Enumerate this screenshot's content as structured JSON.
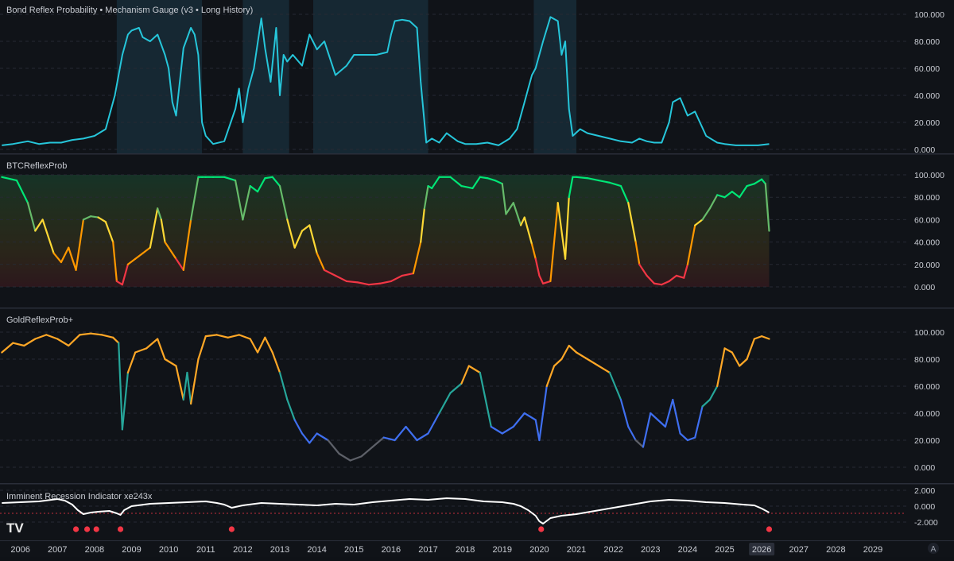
{
  "chart_data": [
    {
      "type": "line",
      "title": "Bond Reflex Probability • Mechanism Gauge (v3 • Long History)",
      "ylim": [
        0,
        100
      ],
      "y_ticks": [
        "100.000",
        "80.000",
        "60.000",
        "40.000",
        "20.000",
        "0.000"
      ],
      "grid": true,
      "line_color": "#26c6da",
      "series": [
        {
          "x": [
            2005.5,
            2005.8,
            2006.2,
            2006.5,
            2006.8,
            2007.1,
            2007.4,
            2007.7,
            2008.0,
            2008.3,
            2008.55,
            2008.75,
            2008.9,
            2009.0,
            2009.2,
            2009.3,
            2009.5,
            2009.7,
            2009.9,
            2010.0,
            2010.1,
            2010.2,
            2010.4,
            2010.6,
            2010.7,
            2010.8,
            2010.9,
            2011.0,
            2011.2,
            2011.5,
            2011.8,
            2011.9,
            2012.0,
            2012.15,
            2012.3,
            2012.5,
            2012.6,
            2012.75,
            2012.9,
            2013.0,
            2013.1,
            2013.2,
            2013.35,
            2013.6,
            2013.8,
            2014.0,
            2014.2,
            2014.5,
            2014.8,
            2015.0,
            2015.3,
            2015.6,
            2015.9,
            2016.0,
            2016.1,
            2016.3,
            2016.5,
            2016.7,
            2016.8,
            2016.95,
            2017.1,
            2017.3,
            2017.5,
            2017.8,
            2018.0,
            2018.3,
            2018.6,
            2018.9,
            2019.2,
            2019.4,
            2019.6,
            2019.7,
            2019.8,
            2019.9,
            2020.0,
            2020.1,
            2020.3,
            2020.5,
            2020.6,
            2020.7,
            2020.8,
            2020.9,
            2021.1,
            2021.3,
            2021.6,
            2021.9,
            2022.2,
            2022.5,
            2022.7,
            2022.9,
            2023.1,
            2023.3,
            2023.5,
            2023.6,
            2023.8,
            2024.0,
            2024.2,
            2024.5,
            2024.8,
            2025.0,
            2025.3,
            2025.6,
            2025.9,
            2026.2
          ],
          "y": [
            3,
            4,
            6,
            4,
            5,
            5,
            7,
            8,
            10,
            15,
            40,
            70,
            85,
            88,
            90,
            83,
            80,
            85,
            70,
            60,
            35,
            25,
            75,
            90,
            85,
            70,
            20,
            10,
            4,
            6,
            30,
            45,
            20,
            45,
            60,
            97,
            75,
            50,
            90,
            40,
            70,
            65,
            70,
            62,
            85,
            74,
            80,
            55,
            62,
            70,
            70,
            70,
            72,
            85,
            95,
            96,
            95,
            90,
            50,
            5,
            8,
            5,
            12,
            6,
            4,
            4,
            5,
            3,
            8,
            15,
            35,
            45,
            55,
            60,
            70,
            80,
            98,
            95,
            70,
            80,
            30,
            10,
            15,
            12,
            10,
            8,
            6,
            5,
            8,
            6,
            5,
            5,
            20,
            35,
            38,
            25,
            28,
            10,
            5,
            4,
            3,
            3,
            3,
            4
          ],
          "highlight_bands": [
            [
              2008.6,
              2010.9
            ],
            [
              2012.0,
              2013.25
            ],
            [
              2013.9,
              2017.0
            ],
            [
              2019.85,
              2021.0
            ]
          ]
        }
      ]
    },
    {
      "type": "line",
      "title": "BTCReflexProb",
      "ylim": [
        0,
        100
      ],
      "y_ticks": [
        "100.000",
        "80.000",
        "60.000",
        "40.000",
        "20.000",
        "0.000"
      ],
      "grid": true,
      "colored_by_value": true,
      "zones": [
        {
          "from": 0,
          "to": 20,
          "color": "#f23645"
        },
        {
          "from": 20,
          "to": 40,
          "color": "#ff9800"
        },
        {
          "from": 40,
          "to": 60,
          "color": "#fdd835"
        },
        {
          "from": 60,
          "to": 80,
          "color": "#66bb6a"
        },
        {
          "from": 80,
          "to": 100,
          "color": "#00e676"
        }
      ],
      "series": [
        {
          "x": [
            2005.5,
            2005.9,
            2006.2,
            2006.4,
            2006.6,
            2006.9,
            2007.1,
            2007.3,
            2007.5,
            2007.7,
            2007.9,
            2008.1,
            2008.3,
            2008.5,
            2008.6,
            2008.75,
            2008.9,
            2009.1,
            2009.3,
            2009.5,
            2009.7,
            2009.8,
            2009.9,
            2010.0,
            2010.2,
            2010.4,
            2010.6,
            2010.8,
            2010.9,
            2011.0,
            2011.2,
            2011.5,
            2011.8,
            2012.0,
            2012.2,
            2012.4,
            2012.6,
            2012.8,
            2013.0,
            2013.2,
            2013.4,
            2013.6,
            2013.8,
            2014.0,
            2014.2,
            2014.5,
            2014.8,
            2015.1,
            2015.4,
            2015.7,
            2016.0,
            2016.3,
            2016.6,
            2016.8,
            2016.9,
            2017.0,
            2017.1,
            2017.3,
            2017.6,
            2017.9,
            2018.2,
            2018.4,
            2018.6,
            2018.8,
            2019.0,
            2019.1,
            2019.3,
            2019.5,
            2019.6,
            2019.8,
            2019.9,
            2020.0,
            2020.1,
            2020.3,
            2020.5,
            2020.7,
            2020.8,
            2020.9,
            2021.0,
            2021.3,
            2021.6,
            2021.9,
            2022.2,
            2022.4,
            2022.6,
            2022.7,
            2022.9,
            2023.1,
            2023.3,
            2023.5,
            2023.7,
            2023.9,
            2024.0,
            2024.2,
            2024.4,
            2024.6,
            2024.8,
            2025.0,
            2025.2,
            2025.4,
            2025.6,
            2025.8,
            2026.0,
            2026.1,
            2026.2
          ],
          "y": [
            98,
            95,
            75,
            50,
            60,
            30,
            22,
            35,
            15,
            60,
            63,
            62,
            58,
            40,
            5,
            2,
            20,
            25,
            30,
            35,
            70,
            60,
            40,
            35,
            25,
            15,
            60,
            98,
            98,
            98,
            98,
            98,
            95,
            60,
            90,
            85,
            97,
            98,
            90,
            60,
            35,
            50,
            55,
            30,
            15,
            10,
            5,
            4,
            2,
            3,
            5,
            10,
            12,
            40,
            70,
            90,
            88,
            98,
            98,
            90,
            88,
            98,
            97,
            95,
            92,
            65,
            75,
            55,
            62,
            38,
            25,
            10,
            3,
            5,
            75,
            25,
            80,
            98,
            98,
            97,
            95,
            93,
            90,
            75,
            40,
            20,
            10,
            3,
            2,
            5,
            10,
            8,
            20,
            55,
            60,
            70,
            82,
            80,
            85,
            80,
            90,
            92,
            96,
            92,
            50
          ]
        }
      ]
    },
    {
      "type": "line",
      "title": "GoldReflexProb+",
      "ylim": [
        0,
        100
      ],
      "y_ticks": [
        "100.000",
        "80.000",
        "60.000",
        "40.000",
        "20.000",
        "0.000"
      ],
      "grid": true,
      "colored_by_value": true,
      "zones": [
        {
          "from": 0,
          "to": 20,
          "color": "#5d6068"
        },
        {
          "from": 20,
          "to": 40,
          "color": "#3f6ff0"
        },
        {
          "from": 40,
          "to": 60,
          "color": "#26a69a"
        },
        {
          "from": 60,
          "to": 100,
          "color": "#ffa726"
        }
      ],
      "series": [
        {
          "x": [
            2005.5,
            2005.8,
            2006.1,
            2006.4,
            2006.7,
            2007.0,
            2007.3,
            2007.6,
            2007.9,
            2008.2,
            2008.5,
            2008.65,
            2008.75,
            2008.9,
            2009.1,
            2009.4,
            2009.7,
            2009.9,
            2010.2,
            2010.4,
            2010.5,
            2010.6,
            2010.8,
            2011.0,
            2011.3,
            2011.6,
            2011.9,
            2012.2,
            2012.4,
            2012.6,
            2012.8,
            2013.0,
            2013.2,
            2013.4,
            2013.6,
            2013.8,
            2014.0,
            2014.3,
            2014.6,
            2014.9,
            2015.2,
            2015.5,
            2015.8,
            2016.1,
            2016.4,
            2016.7,
            2017.0,
            2017.3,
            2017.6,
            2017.9,
            2018.1,
            2018.4,
            2018.7,
            2019.0,
            2019.3,
            2019.6,
            2019.9,
            2020.0,
            2020.2,
            2020.4,
            2020.6,
            2020.8,
            2021.0,
            2021.3,
            2021.6,
            2021.9,
            2022.2,
            2022.4,
            2022.6,
            2022.8,
            2023.0,
            2023.2,
            2023.4,
            2023.6,
            2023.8,
            2024.0,
            2024.2,
            2024.4,
            2024.6,
            2024.8,
            2025.0,
            2025.2,
            2025.4,
            2025.6,
            2025.8,
            2026.0,
            2026.2
          ],
          "y": [
            85,
            92,
            90,
            95,
            98,
            95,
            90,
            98,
            99,
            98,
            96,
            92,
            28,
            70,
            85,
            88,
            95,
            80,
            75,
            50,
            70,
            47,
            80,
            97,
            98,
            96,
            98,
            95,
            85,
            96,
            85,
            70,
            50,
            35,
            25,
            18,
            25,
            20,
            10,
            5,
            8,
            15,
            22,
            20,
            30,
            20,
            25,
            40,
            55,
            62,
            75,
            70,
            30,
            25,
            30,
            40,
            35,
            20,
            60,
            75,
            80,
            90,
            85,
            80,
            75,
            70,
            50,
            30,
            20,
            15,
            40,
            35,
            30,
            50,
            25,
            20,
            22,
            45,
            50,
            60,
            88,
            85,
            75,
            80,
            95,
            97,
            95
          ]
        }
      ]
    },
    {
      "type": "line",
      "title": "Imminent Recession Indicator xe243x",
      "ylim": [
        -2.8,
        2
      ],
      "y_ticks": [
        "2.000",
        "0.000",
        "-2.000"
      ],
      "threshold": -0.9,
      "line_color": "#ffffff",
      "series": [
        {
          "x": [
            2005.5,
            2006.0,
            2006.5,
            2007.0,
            2007.2,
            2007.4,
            2007.55,
            2007.7,
            2007.9,
            2008.1,
            2008.4,
            2008.6,
            2008.7,
            2008.8,
            2009.0,
            2009.5,
            2010.0,
            2010.5,
            2011.0,
            2011.3,
            2011.5,
            2011.7,
            2012.0,
            2012.5,
            2013.0,
            2013.5,
            2014.0,
            2014.5,
            2015.0,
            2015.5,
            2016.0,
            2016.5,
            2017.0,
            2017.5,
            2018.0,
            2018.5,
            2019.0,
            2019.3,
            2019.5,
            2019.7,
            2019.9,
            2020.0,
            2020.1,
            2020.3,
            2020.6,
            2021.0,
            2021.5,
            2022.0,
            2022.5,
            2023.0,
            2023.5,
            2024.0,
            2024.5,
            2025.0,
            2025.5,
            2025.8,
            2026.0,
            2026.2
          ],
          "y": [
            0.4,
            0.5,
            0.6,
            0.9,
            0.7,
            0.2,
            -0.5,
            -1.0,
            -0.8,
            -0.7,
            -0.6,
            -0.9,
            -1.1,
            -0.5,
            0.0,
            0.3,
            0.4,
            0.5,
            0.6,
            0.4,
            0.2,
            -0.2,
            0.1,
            0.4,
            0.3,
            0.2,
            0.1,
            0.3,
            0.2,
            0.5,
            0.7,
            0.9,
            0.8,
            1.0,
            0.9,
            0.6,
            0.5,
            0.3,
            0.0,
            -0.5,
            -1.2,
            -1.9,
            -2.2,
            -1.5,
            -1.2,
            -1.0,
            -0.6,
            -0.2,
            0.2,
            0.6,
            0.8,
            0.7,
            0.5,
            0.4,
            0.2,
            0.1,
            -0.3,
            -0.8
          ]
        }
      ],
      "signal_markers": {
        "x": [
          2007.5,
          2007.8,
          2008.05,
          2008.7,
          2011.7,
          2020.05,
          2026.2
        ],
        "color": "#f23645"
      }
    }
  ],
  "x_axis": {
    "ticks": [
      "2006",
      "2007",
      "2008",
      "2009",
      "2010",
      "2011",
      "2012",
      "2013",
      "2014",
      "2015",
      "2016",
      "2017",
      "2018",
      "2019",
      "2020",
      "2021",
      "2022",
      "2023",
      "2024",
      "2025",
      "2026",
      "2027",
      "2028",
      "2029"
    ],
    "highlighted_tick": "2026"
  },
  "branding": {
    "logo_text": "TV",
    "corner_label": "A"
  }
}
